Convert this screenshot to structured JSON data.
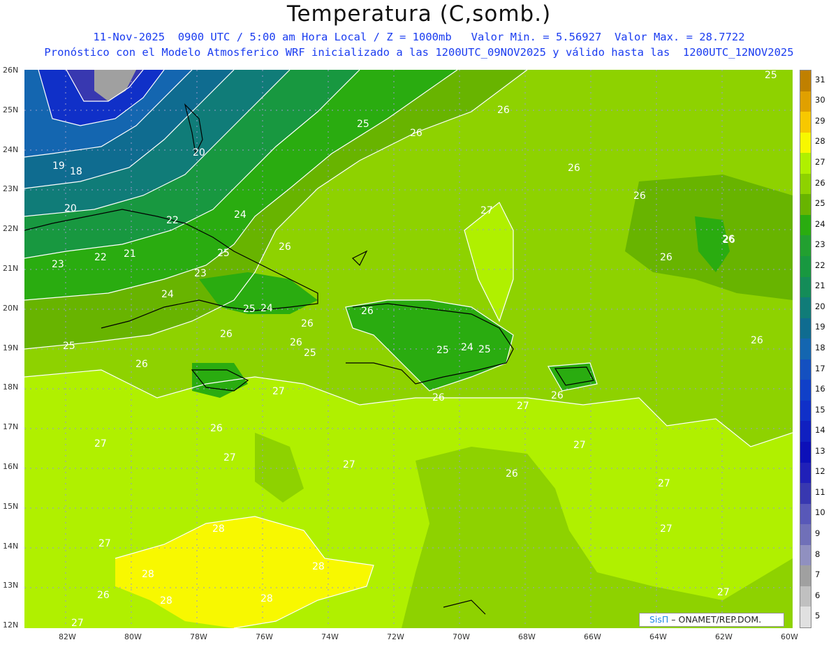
{
  "header": {
    "title": "Temperatura (C,somb.)",
    "subtitle1": "11-Nov-2025  0900 UTC / 5:00 am Hora Local / Z = 1000mb   Valor Min. = 5.56927  Valor Max. = 28.7722",
    "subtitle2": "Pronóstico con el Modelo Atmosferico WRF inicializado a las 1200UTC_09NOV2025 y válido hasta las  1200UTC_12NOV2025"
  },
  "axes": {
    "lat_labels": [
      "26N",
      "25N",
      "24N",
      "23N",
      "22N",
      "21N",
      "20N",
      "19N",
      "18N",
      "17N",
      "16N",
      "15N",
      "14N",
      "13N",
      "12N"
    ],
    "lon_labels": [
      "82W",
      "80W",
      "78W",
      "76W",
      "74W",
      "72W",
      "70W",
      "68W",
      "66W",
      "64W",
      "62W",
      "60W"
    ]
  },
  "colorbar": {
    "levels": [
      "31",
      "30",
      "29",
      "28",
      "27",
      "26",
      "25",
      "24",
      "23",
      "22",
      "21",
      "20",
      "19",
      "18",
      "17",
      "16",
      "15",
      "14",
      "13",
      "12",
      "11",
      "10",
      "9",
      "8",
      "7",
      "6",
      "5"
    ],
    "colors": [
      "#c08000",
      "#e0a000",
      "#f8c800",
      "#f8f800",
      "#b0f000",
      "#8ed200",
      "#68b400",
      "#2aac10",
      "#22a030",
      "#189840",
      "#148c58",
      "#107c78",
      "#0f6c90",
      "#1466b0",
      "#1450c0",
      "#1040c8",
      "#1030c8",
      "#1020c0",
      "#0c10b8",
      "#2020b8",
      "#3838b0",
      "#5858b8",
      "#7070b8",
      "#9090c0",
      "#a0a0a0",
      "#c0c0c0",
      "#e0e0e0"
    ]
  },
  "map_labels": {
    "contours": [
      "25",
      "26",
      "26",
      "26",
      "26",
      "26",
      "25",
      "26",
      "26",
      "27",
      "26",
      "26",
      "19",
      "18",
      "20",
      "20",
      "22",
      "24",
      "26",
      "21",
      "22",
      "23",
      "23",
      "24",
      "25",
      "26",
      "25",
      "24",
      "26",
      "26",
      "25",
      "26",
      "26",
      "26",
      "26",
      "27",
      "27",
      "27",
      "26",
      "27",
      "27",
      "25",
      "24",
      "25",
      "26",
      "27",
      "26",
      "27",
      "27",
      "27",
      "28",
      "28",
      "28",
      "28",
      "28",
      "27",
      "26",
      "27",
      "27",
      "26",
      "26",
      "20",
      "25",
      "25",
      "25",
      "26",
      "26"
    ]
  },
  "credit": {
    "brand": "SisΠ",
    "text": " – ONAMET/REP.DOM."
  }
}
